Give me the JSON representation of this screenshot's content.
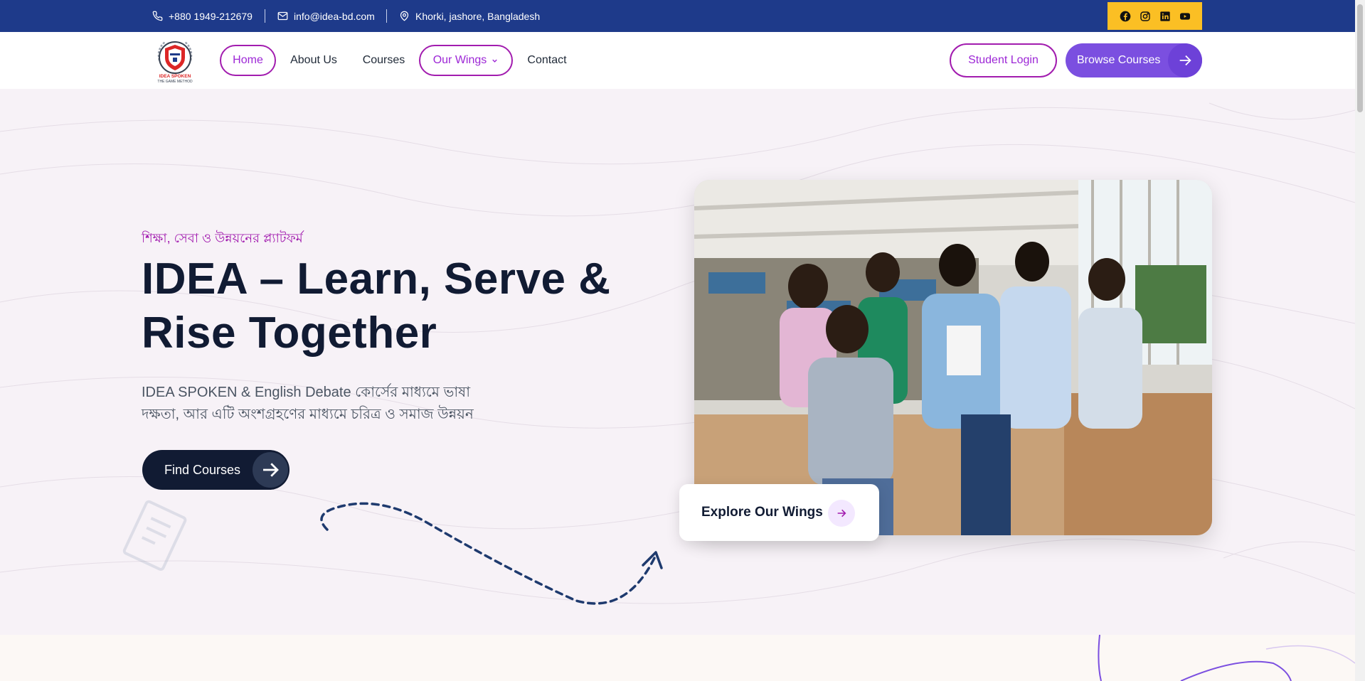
{
  "topbar": {
    "phone": "+880 1949-212679",
    "email": "info@idea-bd.com",
    "address": "Khorki, jashore, Bangladesh",
    "social_icons": [
      "facebook-icon",
      "instagram-icon",
      "linkedin-icon",
      "youtube-icon"
    ],
    "bg_color": "#1e3a8a",
    "social_bg_color": "#fbbf24"
  },
  "nav": {
    "logo_text": "IDEA SPOKEN",
    "logo_subtext": "THE GAME METHOD",
    "links": [
      "Home",
      "About Us",
      "Courses",
      "Our Wings",
      "Contact"
    ],
    "student_login": "Student Login",
    "browse_courses": "Browse Courses",
    "accent_color": "#a21caf",
    "button_color": "#7b4fe0"
  },
  "hero": {
    "tagline": "শিক্ষা, সেবা ও উন্নয়নের প্ল্যাটফর্ম",
    "headline_line1": "IDEA – Learn, Serve &",
    "headline_line2": "Rise Together",
    "description_line1": "IDEA SPOKEN & English Debate কোর্সের মাধ্যমে ভাষা",
    "description_line2": "দক্ষতা, আর এটি অংশগ্রহণের মাধ্যমে চরিত্র ও সমাজ উন্নয়ন",
    "find_courses": "Find Courses",
    "explore_wings": "Explore Our Wings"
  }
}
